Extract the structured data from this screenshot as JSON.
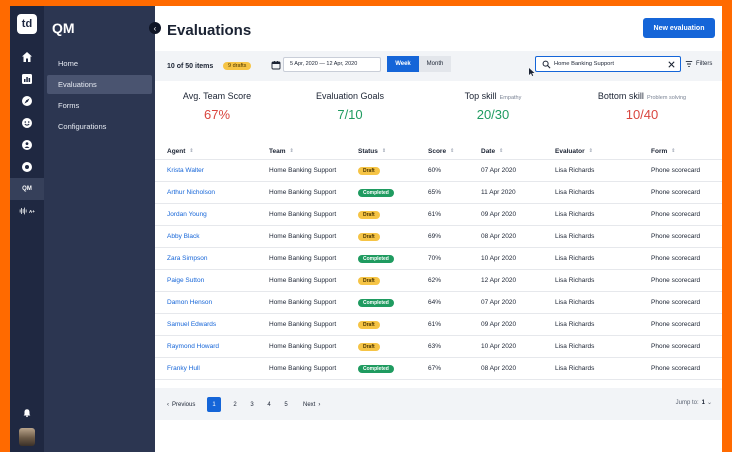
{
  "app": {
    "logo_text": "td",
    "module_title": "QM"
  },
  "rail": {
    "qm_label": "QM",
    "voice_label": "A+"
  },
  "menu": {
    "items": [
      {
        "label": "Home"
      },
      {
        "label": "Evaluations"
      },
      {
        "label": "Forms"
      },
      {
        "label": "Configurations"
      }
    ]
  },
  "header": {
    "title": "Evaluations",
    "new_button": "New evaluation"
  },
  "toolbar": {
    "items_count": "10 of 50 items",
    "drafts_badge": "9 drafts",
    "date_range": "5 Apr, 2020 — 12 Apr, 2020",
    "week_label": "Week",
    "month_label": "Month",
    "search_value": "Home Banking Support",
    "filters_label": "Filters"
  },
  "stats": [
    {
      "label": "Avg. Team Score",
      "sub": "",
      "value": "67%",
      "color": "#d9463f"
    },
    {
      "label": "Evaluation Goals",
      "sub": "",
      "value": "7/10",
      "color": "#1f9b60"
    },
    {
      "label": "Top skill",
      "sub": "Empathy",
      "value": "20/30",
      "color": "#1f9b60"
    },
    {
      "label": "Bottom skill",
      "sub": "Problem solving",
      "value": "10/40",
      "color": "#d9463f"
    }
  ],
  "table": {
    "columns": [
      "Agent",
      "Team",
      "Status",
      "Score",
      "Date",
      "Evaluator",
      "Form"
    ],
    "rows": [
      {
        "agent": "Krista Walter",
        "team": "Home Banking Support",
        "status": "Draft",
        "score": "60%",
        "date": "07 Apr 2020",
        "evaluator": "Lisa Richards",
        "form": "Phone scorecard"
      },
      {
        "agent": "Arthur Nicholson",
        "team": "Home Banking Support",
        "status": "Completed",
        "score": "65%",
        "date": "11 Apr 2020",
        "evaluator": "Lisa Richards",
        "form": "Phone scorecard"
      },
      {
        "agent": "Jordan Young",
        "team": "Home Banking Support",
        "status": "Draft",
        "score": "61%",
        "date": "09 Apr 2020",
        "evaluator": "Lisa Richards",
        "form": "Phone scorecard"
      },
      {
        "agent": "Abby Black",
        "team": "Home Banking Support",
        "status": "Draft",
        "score": "69%",
        "date": "08 Apr 2020",
        "evaluator": "Lisa Richards",
        "form": "Phone scorecard"
      },
      {
        "agent": "Zara Simpson",
        "team": "Home Banking Support",
        "status": "Completed",
        "score": "70%",
        "date": "10 Apr 2020",
        "evaluator": "Lisa Richards",
        "form": "Phone scorecard"
      },
      {
        "agent": "Paige Sutton",
        "team": "Home Banking Support",
        "status": "Draft",
        "score": "62%",
        "date": "12 Apr 2020",
        "evaluator": "Lisa Richards",
        "form": "Phone scorecard"
      },
      {
        "agent": "Damon Henson",
        "team": "Home Banking Support",
        "status": "Completed",
        "score": "64%",
        "date": "07 Apr 2020",
        "evaluator": "Lisa Richards",
        "form": "Phone scorecard"
      },
      {
        "agent": "Samuel Edwards",
        "team": "Home Banking Support",
        "status": "Draft",
        "score": "61%",
        "date": "09 Apr 2020",
        "evaluator": "Lisa Richards",
        "form": "Phone scorecard"
      },
      {
        "agent": "Raymond Howard",
        "team": "Home Banking Support",
        "status": "Draft",
        "score": "63%",
        "date": "10 Apr 2020",
        "evaluator": "Lisa Richards",
        "form": "Phone scorecard"
      },
      {
        "agent": "Franky Hull",
        "team": "Home Banking Support",
        "status": "Completed",
        "score": "67%",
        "date": "08 Apr 2020",
        "evaluator": "Lisa Richards",
        "form": "Phone scorecard"
      }
    ]
  },
  "pagination": {
    "previous": "Previous",
    "next": "Next",
    "pages": [
      "1",
      "2",
      "3",
      "4",
      "5"
    ],
    "jump_label": "Jump to:",
    "jump_value": "1"
  }
}
